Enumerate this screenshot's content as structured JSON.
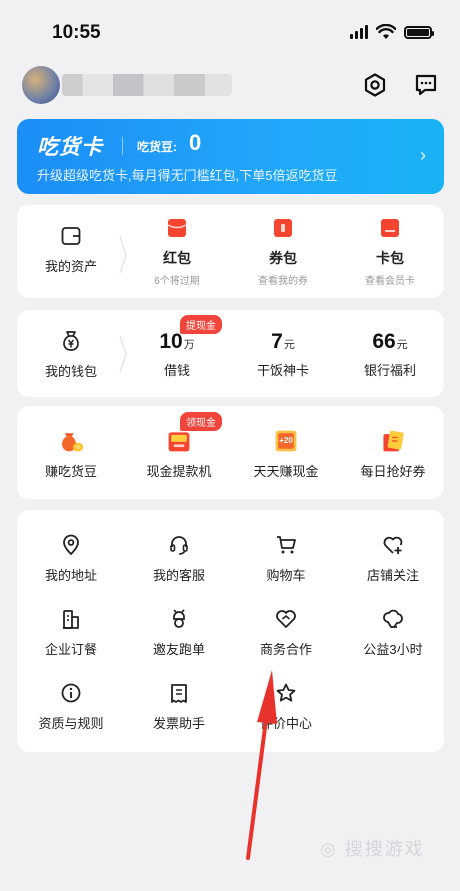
{
  "status_bar": {
    "time": "10:55"
  },
  "vip": {
    "title": "吃货卡",
    "beans_label": "吃货豆:",
    "beans_value": "0",
    "subtitle": "升级超级吃货卡,每月得无门槛红包,下单5倍返吃货豆"
  },
  "assets": {
    "my_assets": "我的资产",
    "items": [
      {
        "label": "红包",
        "sub": "6个将过期"
      },
      {
        "label": "券包",
        "sub": "查看我的券"
      },
      {
        "label": "卡包",
        "sub": "查看会员卡"
      }
    ]
  },
  "wallet": {
    "label": "我的钱包",
    "badge": "提现金",
    "items": [
      {
        "value": "10",
        "unit": "万",
        "label": "借钱"
      },
      {
        "value": "7",
        "unit": "元",
        "label": "干饭神卡"
      },
      {
        "value": "66",
        "unit": "元",
        "label": "银行福利"
      }
    ]
  },
  "earn": {
    "badge": "领现金",
    "items": [
      {
        "label": "赚吃货豆"
      },
      {
        "label": "现金提款机"
      },
      {
        "label": "天天赚现金",
        "coupon_text": "+20"
      },
      {
        "label": "每日抢好券"
      }
    ]
  },
  "services": {
    "items": [
      {
        "label": "我的地址"
      },
      {
        "label": "我的客服"
      },
      {
        "label": "购物车"
      },
      {
        "label": "店铺关注"
      },
      {
        "label": "企业订餐"
      },
      {
        "label": "邀友跑单"
      },
      {
        "label": "商务合作"
      },
      {
        "label": "公益3小时"
      },
      {
        "label": "资质与规则"
      },
      {
        "label": "发票助手"
      },
      {
        "label": "评价中心"
      }
    ]
  },
  "colors": {
    "brand_blue": "#1b8ef8",
    "red": "#f1443b",
    "arrow": "#e8322c"
  }
}
